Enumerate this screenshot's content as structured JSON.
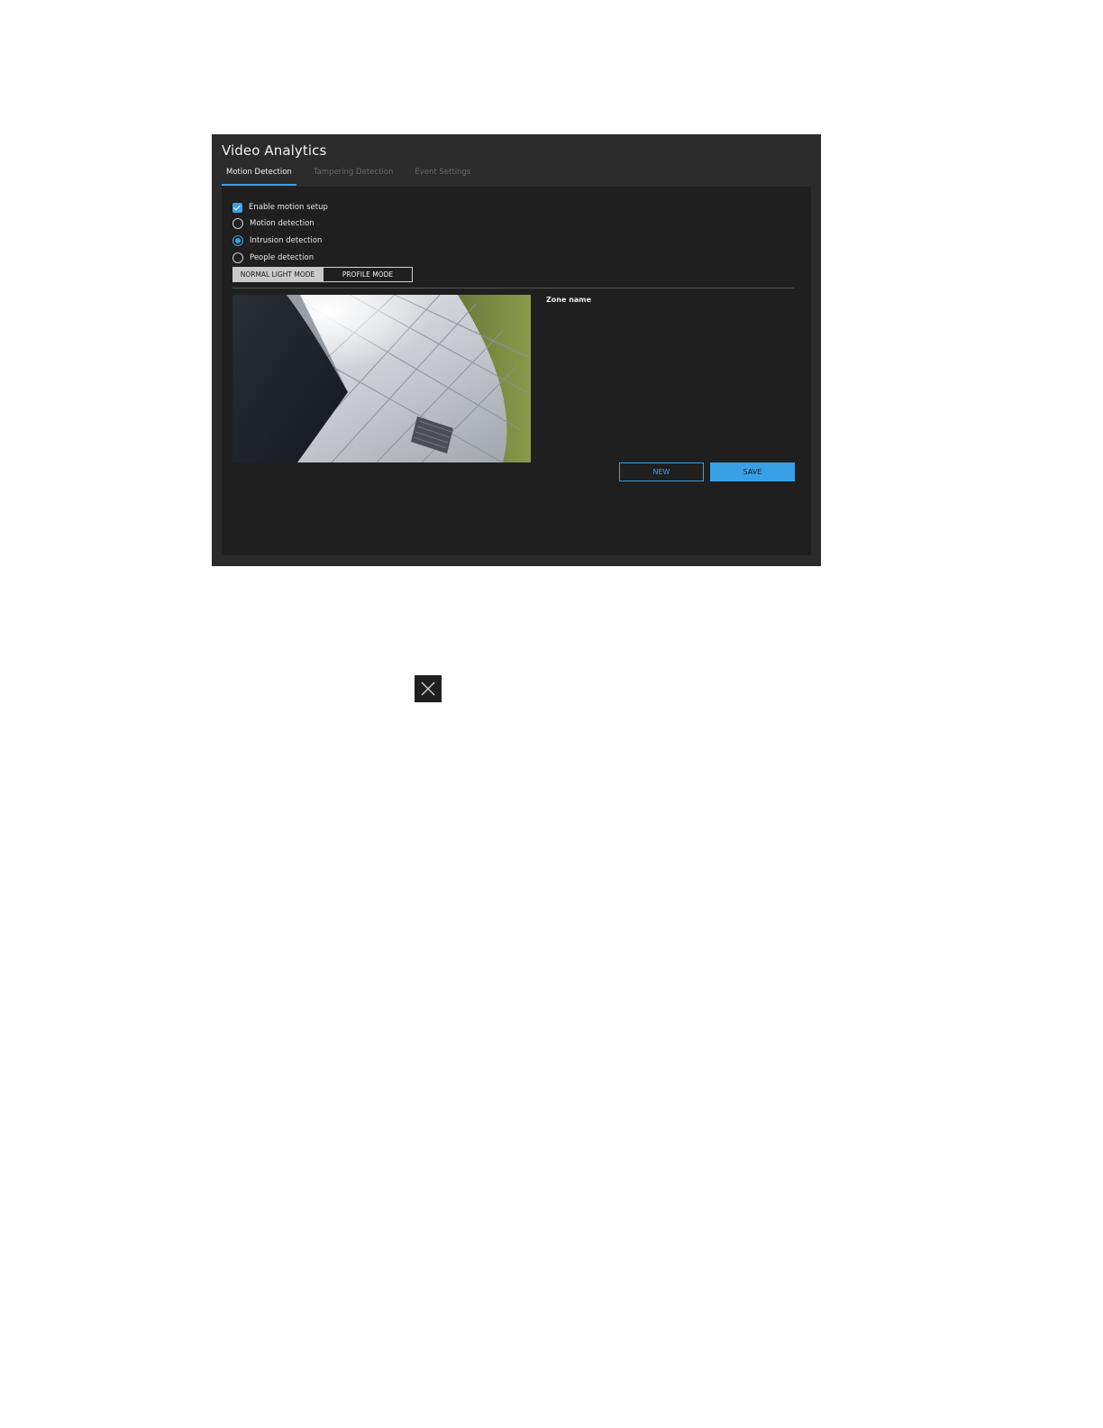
{
  "window": {
    "title": "Video Analytics"
  },
  "tabs": [
    {
      "label": "Motion Detection",
      "active": true
    },
    {
      "label": "Tampering Detection",
      "active": false
    },
    {
      "label": "Event Settings",
      "active": false
    }
  ],
  "options": {
    "enable_motion_setup": {
      "label": "Enable motion setup",
      "checked": true
    },
    "radios": [
      {
        "label": "Motion detection",
        "selected": false
      },
      {
        "label": "Intrusion detection",
        "selected": true
      },
      {
        "label": "People detection",
        "selected": false
      }
    ]
  },
  "modes": {
    "normal_light": "NORMAL LIGHT MODE",
    "profile": "PROFILE MODE",
    "selected": "normal_light"
  },
  "zone": {
    "label": "Zone name"
  },
  "actions": {
    "new_label": "NEW",
    "save_label": "SAVE"
  },
  "colors": {
    "accent": "#3aa0e6",
    "window_bg": "#2b2b2b",
    "panel_bg": "#1f1f1f"
  },
  "icons": {
    "close": "close-icon"
  }
}
